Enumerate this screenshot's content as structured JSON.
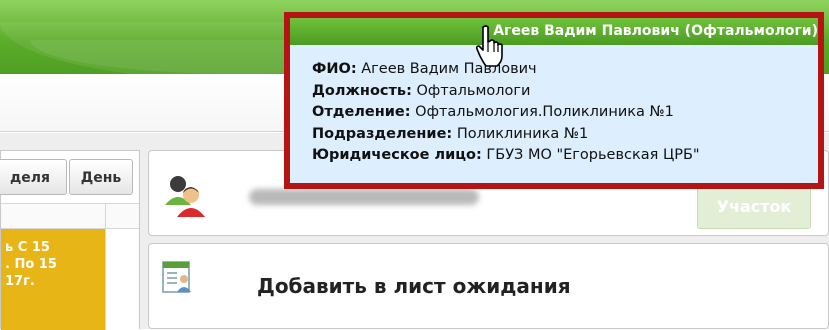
{
  "header": {
    "doctor_title": "Агеев Вадим Павлович (Офтальмологи)"
  },
  "tooltip": {
    "rows": [
      {
        "label": "ФИО:",
        "value": "Агеев Вадим Павлович"
      },
      {
        "label": "Должность:",
        "value": "Офтальмологи"
      },
      {
        "label": "Отделение:",
        "value": "Офтальмология.Поликлиника №1"
      },
      {
        "label": "Подразделение:",
        "value": "Поликлиника №1"
      },
      {
        "label": "Юридическое лицо:",
        "value": "ГБУЗ МО \"Егорьевская ЦРБ\""
      }
    ]
  },
  "calendar": {
    "tabs": {
      "week": "деля",
      "day": "День"
    },
    "slot_lines": [
      "ь С 15",
      ". По 15",
      "17г."
    ],
    "slot_color": "#e8b516"
  },
  "patient_card": {
    "district_button": "Участок",
    "icon": "patients-icon"
  },
  "waitlist_card": {
    "label": "Добавить в лист ожидания",
    "icon": "waitlist-form-icon"
  },
  "colors": {
    "banner_green": "#5cad2b",
    "tooltip_border": "#b41414",
    "tooltip_bg": "#ddeeff"
  }
}
